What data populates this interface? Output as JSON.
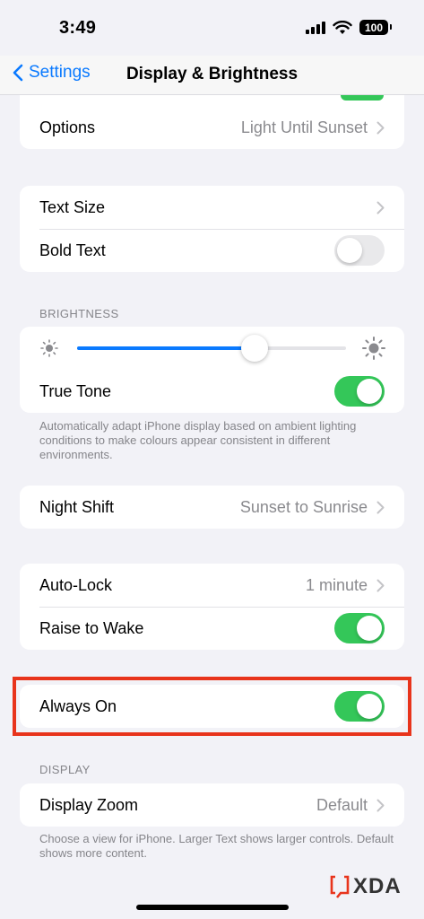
{
  "status": {
    "time": "3:49",
    "battery": "100"
  },
  "nav": {
    "back_label": "Settings",
    "title": "Display & Brightness"
  },
  "appearance_group": {
    "options_label": "Options",
    "options_value": "Light Until Sunset"
  },
  "text_group": {
    "text_size_label": "Text Size",
    "bold_text_label": "Bold Text",
    "bold_text_on": false
  },
  "brightness": {
    "header": "BRIGHTNESS",
    "level": 0.66,
    "true_tone_label": "True Tone",
    "true_tone_on": true,
    "footer": "Automatically adapt iPhone display based on ambient lighting conditions to make colours appear consistent in different environments."
  },
  "night_shift": {
    "label": "Night Shift",
    "value": "Sunset to Sunrise"
  },
  "lock_group": {
    "auto_lock_label": "Auto-Lock",
    "auto_lock_value": "1 minute",
    "raise_to_wake_label": "Raise to Wake",
    "raise_to_wake_on": true
  },
  "always_on": {
    "label": "Always On",
    "on": true
  },
  "display": {
    "header": "DISPLAY",
    "zoom_label": "Display Zoom",
    "zoom_value": "Default",
    "footer": "Choose a view for iPhone. Larger Text shows larger controls. Default shows more content."
  },
  "watermark": {
    "text": "XDA"
  },
  "colors": {
    "accent": "#0a7aff",
    "toggle_on": "#34c759",
    "highlight": "#e8341c"
  },
  "icons": [
    "chevron-left-icon",
    "chevron-right-icon",
    "sun-small-icon",
    "sun-large-icon",
    "wifi-icon",
    "signal-icon",
    "battery-icon"
  ]
}
